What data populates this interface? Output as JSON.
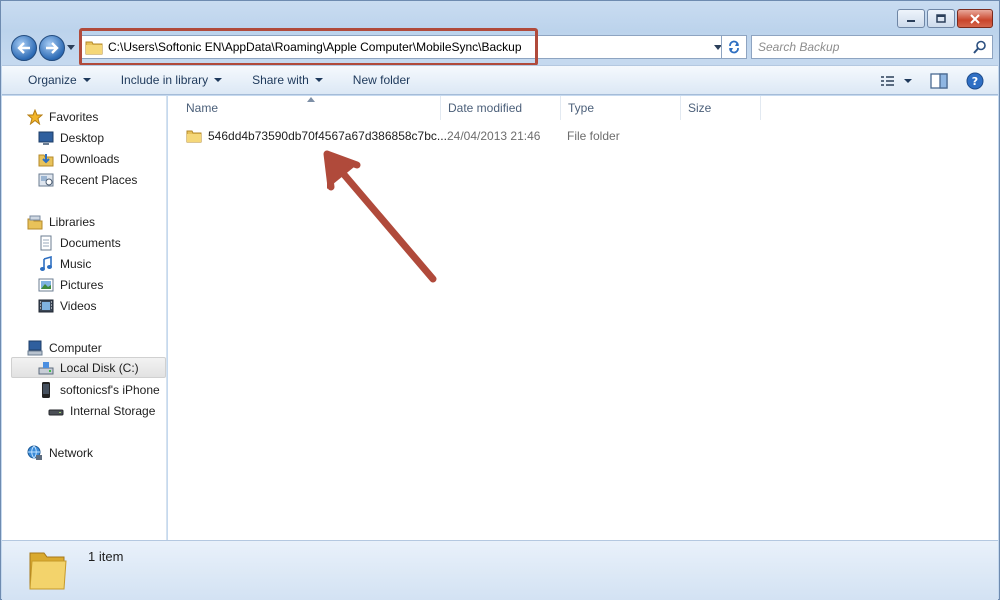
{
  "window": {
    "accent": "#b04a3b"
  },
  "address": {
    "path": "C:\\Users\\Softonic EN\\AppData\\Roaming\\Apple Computer\\MobileSync\\Backup"
  },
  "search": {
    "placeholder": "Search Backup"
  },
  "toolbar": {
    "organize": "Organize",
    "include_in_library": "Include in library",
    "share_with": "Share with",
    "new_folder": "New folder"
  },
  "sidebar": {
    "favorites": "Favorites",
    "desktop": "Desktop",
    "downloads": "Downloads",
    "recent_places": "Recent Places",
    "libraries": "Libraries",
    "documents": "Documents",
    "music": "Music",
    "pictures": "Pictures",
    "videos": "Videos",
    "computer": "Computer",
    "local_disk": "Local Disk (C:)",
    "iphone": "softonicsf's iPhone",
    "internal_storage": "Internal Storage",
    "network": "Network"
  },
  "columns": {
    "name": "Name",
    "date_modified": "Date modified",
    "type": "Type",
    "size": "Size"
  },
  "files": [
    {
      "name": "546dd4b73590db70f4567a67d386858c7bc...",
      "date_modified": "24/04/2013 21:46",
      "type": "File folder",
      "size": ""
    }
  ],
  "status": {
    "item_count": "1 item"
  },
  "icons": [
    "back-icon",
    "forward-icon",
    "folder-icon",
    "refresh-icon",
    "search-icon",
    "star-icon",
    "desktop-icon",
    "downloads-icon",
    "recent-places-icon",
    "library-icon",
    "document-icon",
    "music-icon",
    "pictures-icon",
    "videos-icon",
    "computer-icon",
    "disk-icon",
    "phone-icon",
    "storage-icon",
    "network-icon",
    "view-icon",
    "preview-pane-icon",
    "help-icon"
  ]
}
